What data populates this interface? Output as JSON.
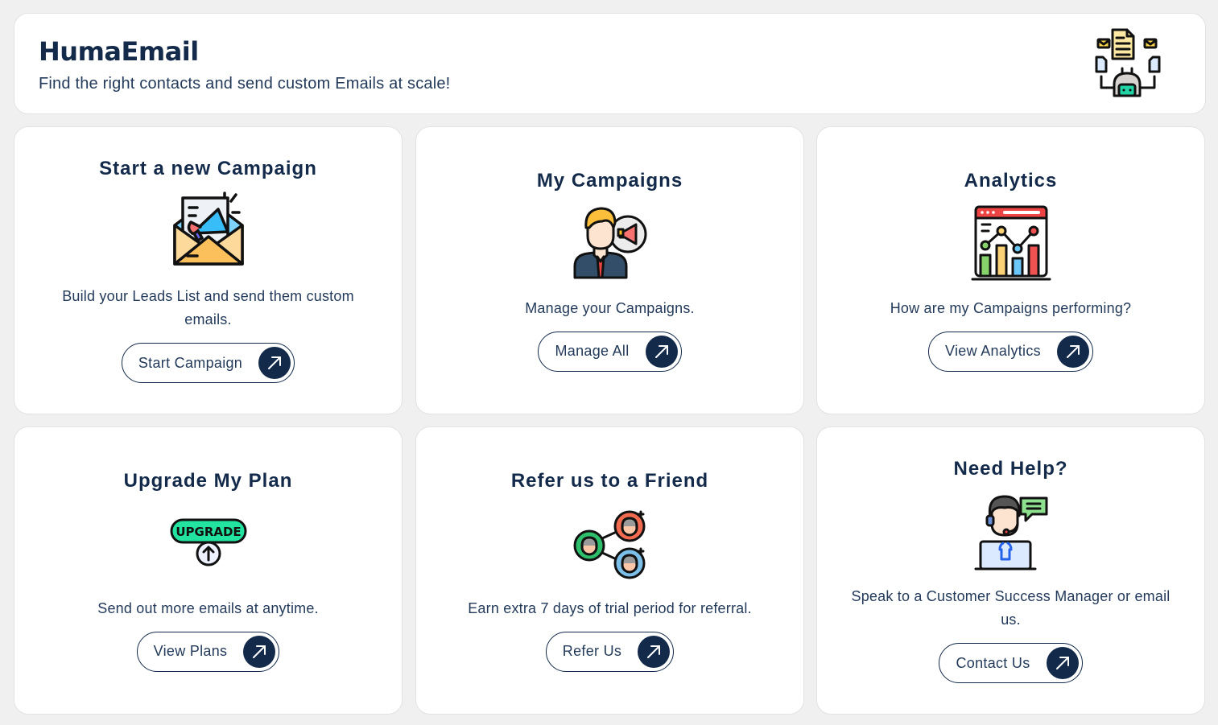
{
  "header": {
    "brand": "HumaEmail",
    "tagline": "Find the right contacts and send custom Emails at scale!",
    "logo_icon": "email-automation-robot-icon"
  },
  "cards": [
    {
      "title": "Start a new Campaign",
      "icon": "envelope-megaphone-icon",
      "description": "Build your Leads List and send them custom emails.",
      "button_label": "Start Campaign"
    },
    {
      "title": "My Campaigns",
      "icon": "businessman-megaphone-icon",
      "description": "Manage your Campaigns.",
      "button_label": "Manage All"
    },
    {
      "title": "Analytics",
      "icon": "analytics-chart-icon",
      "description": "How are my Campaigns performing?",
      "button_label": "View Analytics"
    },
    {
      "title": "Upgrade My Plan",
      "icon": "upgrade-badge-icon",
      "icon_text": "UPGRADE",
      "description": "Send out more emails at anytime.",
      "button_label": "View Plans"
    },
    {
      "title": "Refer us to a Friend",
      "icon": "referral-network-icon",
      "description": "Earn extra 7 days of trial period for referral.",
      "button_label": "Refer Us"
    },
    {
      "title": "Need Help?",
      "icon": "support-agent-icon",
      "description": "Speak to a Customer Success Manager or email us.",
      "button_label": "Contact Us"
    }
  ],
  "colors": {
    "navy": "#132a4b",
    "background": "#f0f0f0",
    "card": "#ffffff"
  }
}
